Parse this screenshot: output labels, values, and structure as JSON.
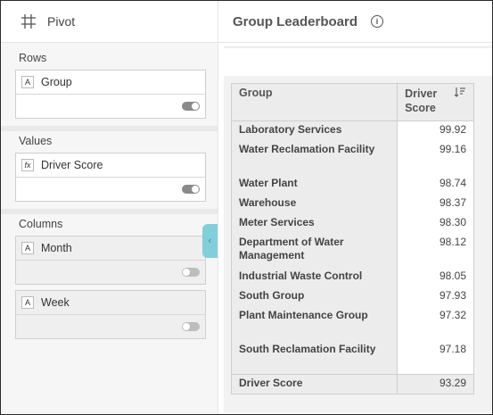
{
  "sidebar": {
    "title": "Pivot",
    "rows": {
      "label": "Rows",
      "fields": [
        {
          "type": "A",
          "name": "Group",
          "enabled": true
        }
      ]
    },
    "values": {
      "label": "Values",
      "fields": [
        {
          "type": "fx",
          "name": "Driver Score",
          "enabled": true
        }
      ]
    },
    "columns": {
      "label": "Columns",
      "fields": [
        {
          "type": "A",
          "name": "Month",
          "enabled": false
        },
        {
          "type": "A",
          "name": "Week",
          "enabled": false
        }
      ]
    }
  },
  "main": {
    "title": "Group Leaderboard",
    "info_icon": "i",
    "table": {
      "headers": {
        "group": "Group",
        "score": "Driver Score"
      },
      "rows": [
        {
          "group": "Laboratory Services",
          "score": "99.92"
        },
        {
          "group": "Water Reclamation Facility",
          "score": "99.16"
        },
        {
          "group": "Water Plant",
          "score": "98.74"
        },
        {
          "group": "Warehouse",
          "score": "98.37"
        },
        {
          "group": "Meter Services",
          "score": "98.30"
        },
        {
          "group": "Department of Water Management",
          "score": "98.12"
        },
        {
          "group": "Industrial Waste Control",
          "score": "98.05"
        },
        {
          "group": "South Group",
          "score": "97.93"
        },
        {
          "group": "Plant Maintenance Group",
          "score": "97.32"
        },
        {
          "group": "South Reclamation Facility",
          "score": "97.18"
        }
      ],
      "total": {
        "label": "Driver Score",
        "score": "93.29"
      }
    }
  },
  "colors": {
    "accent": "#83cfd9"
  }
}
